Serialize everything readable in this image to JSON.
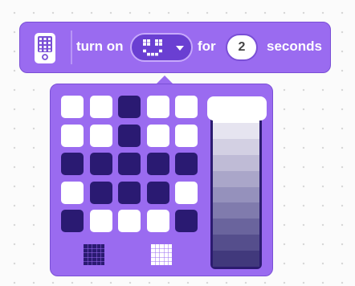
{
  "block": {
    "label_turn_on": "turn on",
    "label_for": "for",
    "duration_value": "2",
    "label_seconds": "seconds",
    "icon": "hub-device-icon",
    "colors": {
      "block": "#9a6bf0",
      "border": "#7a4fd6",
      "dropdown": "#6a3fd2"
    }
  },
  "matrix": {
    "rows": [
      [
        1,
        1,
        0,
        1,
        1
      ],
      [
        1,
        1,
        0,
        1,
        1
      ],
      [
        0,
        0,
        0,
        0,
        0
      ],
      [
        1,
        0,
        0,
        0,
        1
      ],
      [
        0,
        1,
        1,
        1,
        0
      ]
    ],
    "colors": {
      "on": "#ffffff",
      "off": "#2a1a72"
    }
  },
  "brightness": {
    "value_fraction": 1.0,
    "levels": 10,
    "colors": [
      "#ffffff",
      "#e6e4f0",
      "#d3d0e3",
      "#bfbbd6",
      "#aaa6c9",
      "#9591bc",
      "#807bad",
      "#6a649d",
      "#554e8c",
      "#41397c"
    ]
  },
  "presets": [
    {
      "icon": "all-pixels-off-icon"
    },
    {
      "icon": "all-pixels-on-icon"
    }
  ]
}
